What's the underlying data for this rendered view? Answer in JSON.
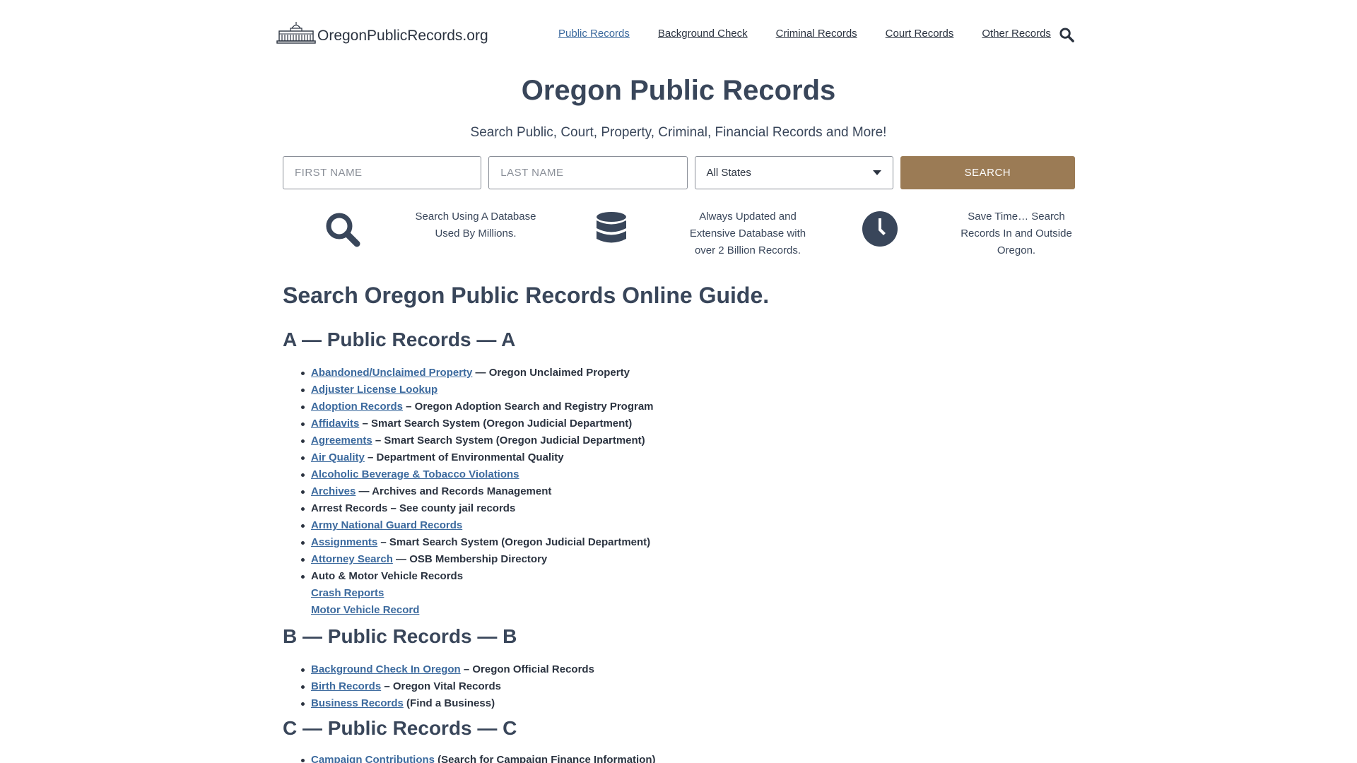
{
  "header": {
    "logo_text": "OregonPublicRecords.org",
    "nav": [
      {
        "label": "Public Records",
        "active": true
      },
      {
        "label": "Background Check"
      },
      {
        "label": "Criminal Records"
      },
      {
        "label": "Court Records"
      },
      {
        "label": "Other Records"
      }
    ],
    "search_icon": "search-icon"
  },
  "hero": {
    "title": "Oregon Public Records",
    "subtitle": "Search Public, Court, Property, Criminal, Financial Records and More!"
  },
  "search_form": {
    "first_name_placeholder": "FIRST NAME",
    "last_name_placeholder": "LAST NAME",
    "state_selected": "All States",
    "button_label": "SEARCH"
  },
  "features": [
    {
      "icon": "search-icon",
      "lines": [
        "Search Using A Database",
        "Used By Millions."
      ]
    },
    {
      "icon": "database-icon",
      "lines": [
        "Always Updated and",
        "Extensive Database with",
        "over 2 Billion Records."
      ]
    },
    {
      "icon": "clock-icon",
      "lines": [
        "Save Time… Search",
        "Records In and Outside",
        "Oregon."
      ]
    }
  ],
  "guide": {
    "title": "Search Oregon Public Records Online Guide.",
    "sections": [
      {
        "heading": "A — Public Records — A",
        "items": [
          {
            "link": "Abandoned/Unclaimed Property",
            "text": " — Oregon Unclaimed Property"
          },
          {
            "link": "Adjuster License Lookup",
            "text": ""
          },
          {
            "link": "Adoption Records",
            "text": " – Oregon Adoption Search and Registry Program"
          },
          {
            "link": "Affidavits",
            "text": " – Smart Search System (Oregon Judicial Department)"
          },
          {
            "link": "Agreements",
            "text": " – Smart Search System (Oregon Judicial Department)"
          },
          {
            "link": "Air Quality",
            "text": " – Department of Environmental Quality"
          },
          {
            "link": "Alcoholic Beverage & Tobacco Violations",
            "text": ""
          },
          {
            "link": "Archives",
            "text": " — Archives and Records Management"
          },
          {
            "link": "",
            "text": "Arrest Records – See county jail records"
          },
          {
            "link": "Army National Guard Records",
            "text": ""
          },
          {
            "link": "Assignments",
            "text": " – Smart Search System (Oregon Judicial Department)"
          },
          {
            "link": "Attorney Search",
            "text": " — OSB Membership Directory"
          },
          {
            "link": "",
            "text": "Auto & Motor Vehicle Records"
          },
          {
            "link": "Crash Reports",
            "text": "",
            "sub": true
          },
          {
            "link": "Motor Vehicle Record",
            "text": "",
            "sub": true
          }
        ]
      },
      {
        "heading": "B — Public Records — B",
        "items": [
          {
            "link": "Background Check In Oregon",
            "text": " – Oregon Official Records"
          },
          {
            "link": "Birth Records",
            "text": " – Oregon Vital Records"
          },
          {
            "link": "Business Records",
            "text": " (Find a Business)"
          }
        ]
      },
      {
        "heading": "C — Public Records — C",
        "items": [
          {
            "link": "Campaign Contributions",
            "text": " (Search for Campaign Finance Information)"
          }
        ]
      }
    ]
  },
  "colors": {
    "link": "#3c6a9e",
    "text": "#2b3340",
    "heading": "#39465a",
    "button": "#9b7b55"
  }
}
